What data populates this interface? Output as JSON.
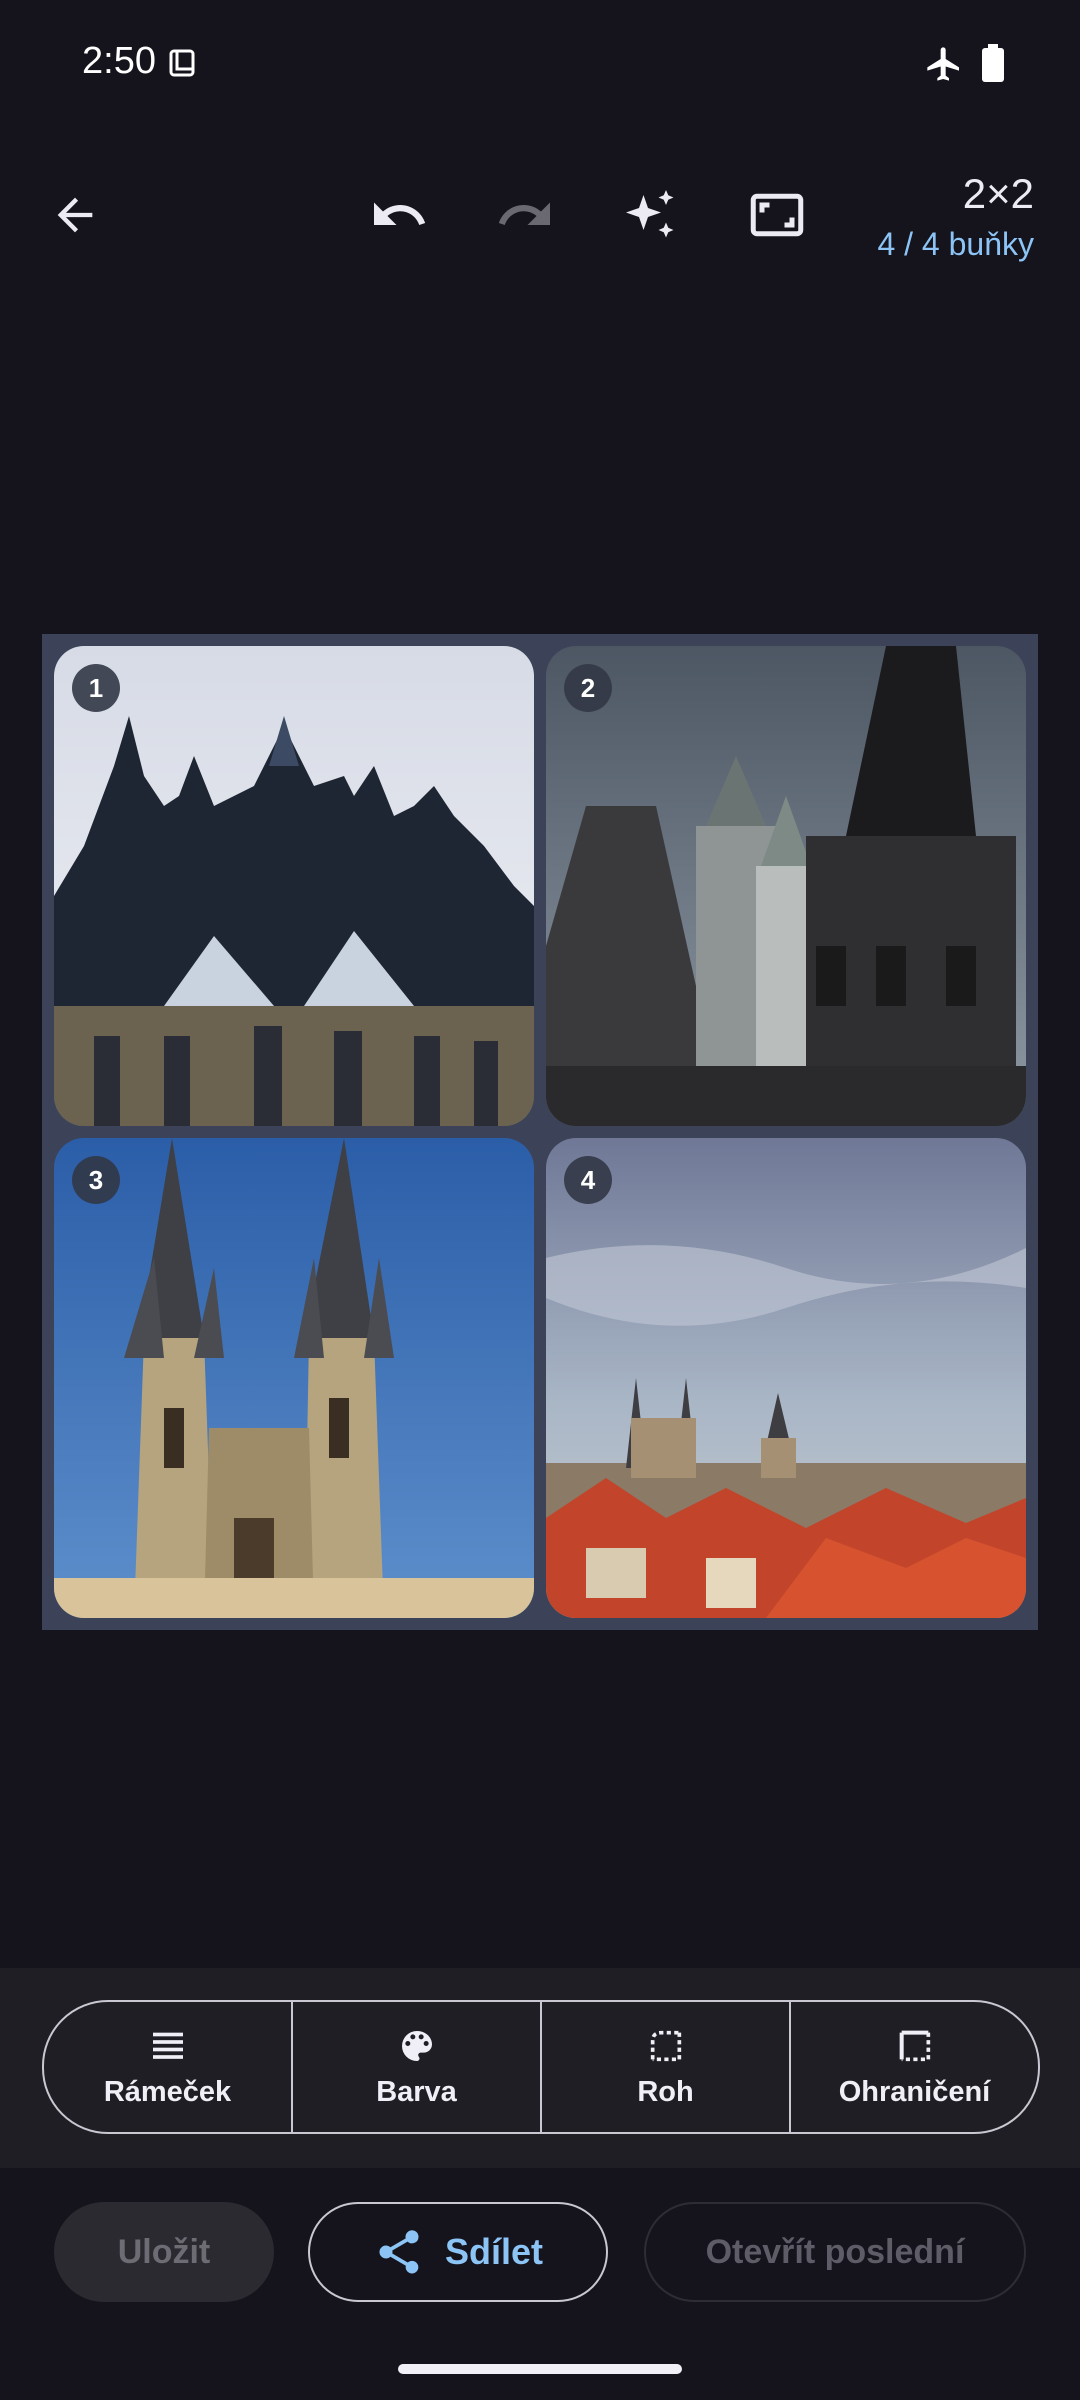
{
  "status_bar": {
    "time": "2:50",
    "icons": [
      "sim-card-icon",
      "airplane-mode-icon",
      "battery-icon"
    ]
  },
  "toolbar": {
    "icons": [
      "back-arrow-icon",
      "undo-icon",
      "redo-icon",
      "sparkle-icon",
      "aspect-ratio-icon"
    ],
    "grid_label": "2×2",
    "cells_label": "4 / 4 buňky"
  },
  "collage": {
    "cells": [
      {
        "badge": "1"
      },
      {
        "badge": "2"
      },
      {
        "badge": "3"
      },
      {
        "badge": "4"
      }
    ]
  },
  "options": {
    "frame": "Rámeček",
    "color": "Barva",
    "corner": "Roh",
    "border": "Ohraničení"
  },
  "actions": {
    "save": "Uložit",
    "share": "Sdílet",
    "open_last": "Otevřít poslední"
  },
  "colors": {
    "background": "#15131b",
    "accent": "#8cc4f6",
    "frame": "#3c4358"
  }
}
